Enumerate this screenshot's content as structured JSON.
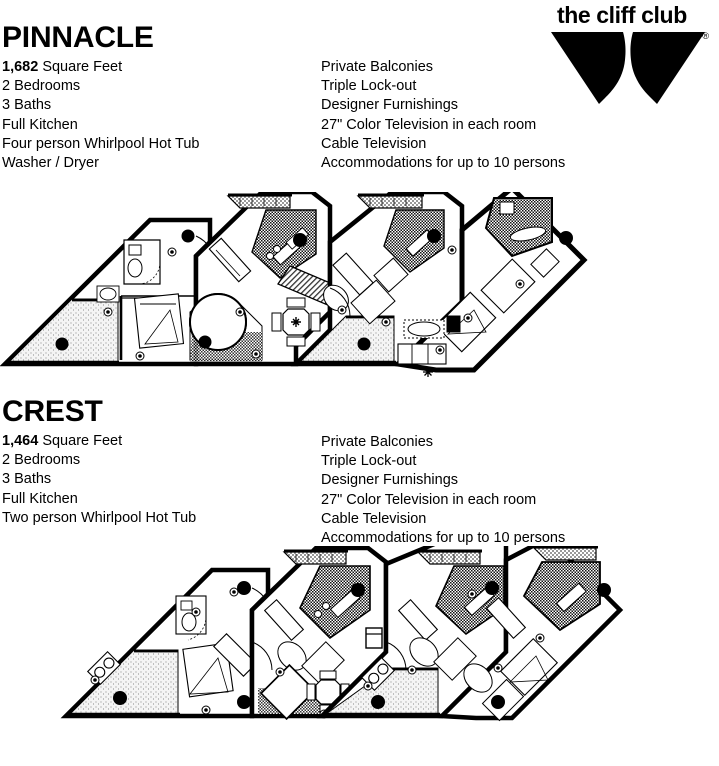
{
  "logo": {
    "wordmark": "the cliff club",
    "registered_mark": "®",
    "mark_name": "cliff-club-wing-mark"
  },
  "units": [
    {
      "id": "pinnacle",
      "title": "PINNACLE",
      "square_feet_value": "1,682",
      "square_feet_label": " Square Feet",
      "features_left": [
        "2 Bedrooms",
        "3 Baths",
        "Full Kitchen",
        "Four person Whirlpool Hot Tub",
        "Washer / Dryer"
      ],
      "features_right": [
        "Private Balconies",
        "Triple Lock-out",
        "Designer Furnishings",
        "27\" Color Television in each room",
        "Cable Television",
        "Accommodations for up to 10 persons"
      ],
      "floorplan_name": "pinnacle-floor-plan"
    },
    {
      "id": "crest",
      "title": "CREST",
      "square_feet_value": "1,464",
      "square_feet_label": " Square Feet",
      "features_left": [
        "2 Bedrooms",
        "3 Baths",
        "Full Kitchen",
        "Two person Whirlpool Hot Tub"
      ],
      "features_right": [
        "Private Balconies",
        "Triple Lock-out",
        "Designer Furnishings",
        "27\" Color Television in each room",
        "Cable Television",
        "Accommodations for up to 10 persons"
      ],
      "floorplan_name": "crest-floor-plan"
    }
  ],
  "colors": {
    "ink": "#000000",
    "paper": "#ffffff",
    "line": "#1a1a1a",
    "light_fill": "#f2f2f2",
    "deck_fill": "#ededed"
  }
}
